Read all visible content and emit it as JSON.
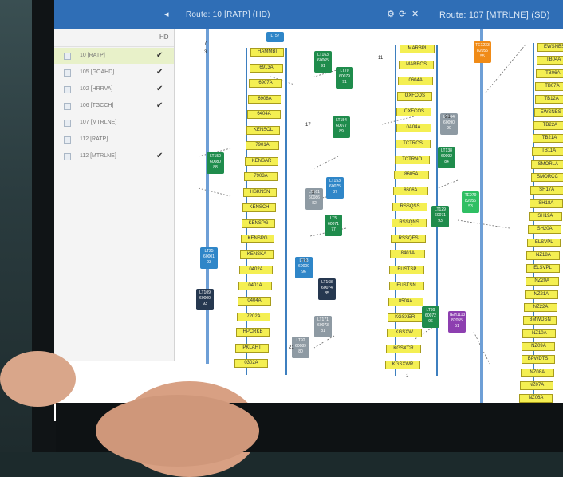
{
  "window": {
    "title_left": "Route: 10 [RATP] (HD)",
    "title_right": "Route: 107 [MTRLNE] (SD)",
    "icons": [
      "chevron-left-icon",
      "gear-icon",
      "refresh-icon",
      "close-icon"
    ]
  },
  "panel": {
    "header_label": "",
    "header_hd": "HD",
    "routes": [
      {
        "name": "10 [RATP]",
        "checked": true
      },
      {
        "name": "105 [GOAHD]",
        "checked": true
      },
      {
        "name": "102 [HRRVA]",
        "checked": true
      },
      {
        "name": "106 [TGCCH]",
        "checked": true
      },
      {
        "name": "107 [MTRLNE]",
        "checked": false
      },
      {
        "name": "112 [RATP]",
        "checked": false
      },
      {
        "name": "112 [MTRLNE]",
        "checked": true
      }
    ]
  },
  "line1": {
    "stations": [
      "HAMMBI",
      "6913A",
      "6907A",
      "6908A",
      "6404A",
      "KENSOL",
      "7901A",
      "KENSAR",
      "7903A",
      "HSKNSN",
      "KENSCH",
      "KENSPG",
      "KENSPG",
      "KENSKA",
      "0402A",
      "0401A",
      "0404A",
      "7202A",
      "HPCRKB",
      "PKLAHT",
      "0302A"
    ]
  },
  "line2": {
    "stations": [
      "MARBPI",
      "MARBOS",
      "0604A",
      "OXFCOS",
      "OXFCOS",
      "0A04A",
      "TCTROS",
      "TCTRNO",
      "8605A",
      "8606A",
      "RSSQSS",
      "RSSQNS",
      "RSSQES",
      "8401A",
      "EUSTSP",
      "EUSTSN",
      "8504A",
      "KGSXER",
      "KGSXW",
      "KGSXCR",
      "KGSXWR"
    ]
  },
  "line3": {
    "stations": [
      "EWSNBS",
      "TB04A",
      "TB06A",
      "TB07A",
      "TB12A",
      "EWSNBS",
      "TB22A",
      "TB21A",
      "TB11A",
      "SMORLA",
      "SMORCC",
      "SH17A",
      "SH18A",
      "SH19A",
      "SH20A",
      "ELSVPL",
      "NZ18A",
      "ELSVPL",
      "NZ20A",
      "NZ21A",
      "NZ22A",
      "BMWDSN",
      "NZ10A",
      "NZ09A",
      "BPWDTS",
      "NZ08A",
      "NZ07A",
      "NZ06A",
      "NZ23A"
    ]
  },
  "trains": [
    {
      "id": "LT57",
      "color": "blue",
      "line2": "",
      "line3": ""
    },
    {
      "id": "LT163",
      "color": "green",
      "line2": "60065",
      "line3": "91"
    },
    {
      "id": "LT70",
      "color": "green",
      "line2": "60079",
      "line3": "91"
    },
    {
      "id": "LT154",
      "color": "green",
      "line2": "60077",
      "line3": "89"
    },
    {
      "id": "LT150",
      "color": "green",
      "line2": "60080",
      "line3": "88"
    },
    {
      "id": "LT161",
      "color": "gray",
      "line2": "60086",
      "line3": "82"
    },
    {
      "id": "LT153",
      "color": "blue",
      "line2": "60075",
      "line3": "87"
    },
    {
      "id": "LT5",
      "color": "green",
      "line2": "60071",
      "line3": "77"
    },
    {
      "id": "LT25",
      "color": "blue",
      "line2": "60001",
      "line3": "93"
    },
    {
      "id": "LT83",
      "color": "blue",
      "line2": "60000",
      "line3": "96"
    },
    {
      "id": "LT168",
      "color": "navy",
      "line2": "60074",
      "line3": "85"
    },
    {
      "id": "LT109",
      "color": "navy",
      "line2": "60000",
      "line3": "93"
    },
    {
      "id": "LT171",
      "color": "gray",
      "line2": "60073",
      "line3": "81"
    },
    {
      "id": "LT92",
      "color": "gray",
      "line2": "60089",
      "line3": "80"
    },
    {
      "id": "LT164",
      "color": "gray",
      "line2": "60090",
      "line3": "90"
    },
    {
      "id": "LT138",
      "color": "green",
      "line2": "60092",
      "line3": "84"
    },
    {
      "id": "LT129",
      "color": "green",
      "line2": "60071",
      "line3": "93"
    },
    {
      "id": "LT99",
      "color": "green",
      "line2": "60072",
      "line3": "96"
    },
    {
      "id": "TE1233",
      "color": "orange",
      "line2": "82055",
      "line3": "55"
    },
    {
      "id": "TE979",
      "color": "lgreen",
      "line2": "82056",
      "line3": "53"
    },
    {
      "id": "TEH1113",
      "color": "purple",
      "line2": "82055",
      "line3": "51"
    }
  ],
  "counts": [
    "7",
    "3",
    "11",
    "17",
    "21",
    "5",
    "13",
    "21",
    "1"
  ]
}
